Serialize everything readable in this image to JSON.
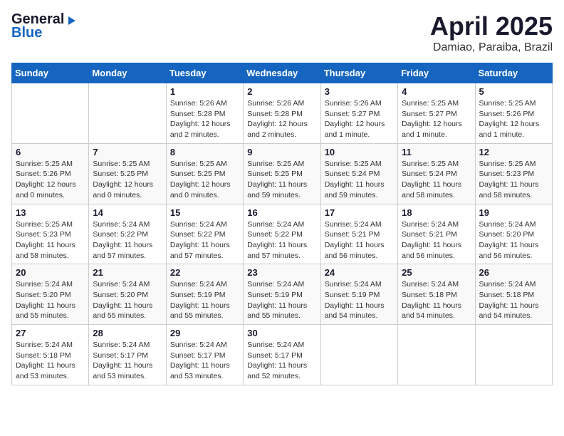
{
  "header": {
    "logo_general": "General",
    "logo_blue": "Blue",
    "month_year": "April 2025",
    "location": "Damiao, Paraiba, Brazil"
  },
  "calendar": {
    "days_of_week": [
      "Sunday",
      "Monday",
      "Tuesday",
      "Wednesday",
      "Thursday",
      "Friday",
      "Saturday"
    ],
    "weeks": [
      [
        {
          "day": "",
          "info": ""
        },
        {
          "day": "",
          "info": ""
        },
        {
          "day": "1",
          "info": "Sunrise: 5:26 AM\nSunset: 5:28 PM\nDaylight: 12 hours\nand 2 minutes."
        },
        {
          "day": "2",
          "info": "Sunrise: 5:26 AM\nSunset: 5:28 PM\nDaylight: 12 hours\nand 2 minutes."
        },
        {
          "day": "3",
          "info": "Sunrise: 5:26 AM\nSunset: 5:27 PM\nDaylight: 12 hours\nand 1 minute."
        },
        {
          "day": "4",
          "info": "Sunrise: 5:25 AM\nSunset: 5:27 PM\nDaylight: 12 hours\nand 1 minute."
        },
        {
          "day": "5",
          "info": "Sunrise: 5:25 AM\nSunset: 5:26 PM\nDaylight: 12 hours\nand 1 minute."
        }
      ],
      [
        {
          "day": "6",
          "info": "Sunrise: 5:25 AM\nSunset: 5:26 PM\nDaylight: 12 hours\nand 0 minutes."
        },
        {
          "day": "7",
          "info": "Sunrise: 5:25 AM\nSunset: 5:25 PM\nDaylight: 12 hours\nand 0 minutes."
        },
        {
          "day": "8",
          "info": "Sunrise: 5:25 AM\nSunset: 5:25 PM\nDaylight: 12 hours\nand 0 minutes."
        },
        {
          "day": "9",
          "info": "Sunrise: 5:25 AM\nSunset: 5:25 PM\nDaylight: 11 hours\nand 59 minutes."
        },
        {
          "day": "10",
          "info": "Sunrise: 5:25 AM\nSunset: 5:24 PM\nDaylight: 11 hours\nand 59 minutes."
        },
        {
          "day": "11",
          "info": "Sunrise: 5:25 AM\nSunset: 5:24 PM\nDaylight: 11 hours\nand 58 minutes."
        },
        {
          "day": "12",
          "info": "Sunrise: 5:25 AM\nSunset: 5:23 PM\nDaylight: 11 hours\nand 58 minutes."
        }
      ],
      [
        {
          "day": "13",
          "info": "Sunrise: 5:25 AM\nSunset: 5:23 PM\nDaylight: 11 hours\nand 58 minutes."
        },
        {
          "day": "14",
          "info": "Sunrise: 5:24 AM\nSunset: 5:22 PM\nDaylight: 11 hours\nand 57 minutes."
        },
        {
          "day": "15",
          "info": "Sunrise: 5:24 AM\nSunset: 5:22 PM\nDaylight: 11 hours\nand 57 minutes."
        },
        {
          "day": "16",
          "info": "Sunrise: 5:24 AM\nSunset: 5:22 PM\nDaylight: 11 hours\nand 57 minutes."
        },
        {
          "day": "17",
          "info": "Sunrise: 5:24 AM\nSunset: 5:21 PM\nDaylight: 11 hours\nand 56 minutes."
        },
        {
          "day": "18",
          "info": "Sunrise: 5:24 AM\nSunset: 5:21 PM\nDaylight: 11 hours\nand 56 minutes."
        },
        {
          "day": "19",
          "info": "Sunrise: 5:24 AM\nSunset: 5:20 PM\nDaylight: 11 hours\nand 56 minutes."
        }
      ],
      [
        {
          "day": "20",
          "info": "Sunrise: 5:24 AM\nSunset: 5:20 PM\nDaylight: 11 hours\nand 55 minutes."
        },
        {
          "day": "21",
          "info": "Sunrise: 5:24 AM\nSunset: 5:20 PM\nDaylight: 11 hours\nand 55 minutes."
        },
        {
          "day": "22",
          "info": "Sunrise: 5:24 AM\nSunset: 5:19 PM\nDaylight: 11 hours\nand 55 minutes."
        },
        {
          "day": "23",
          "info": "Sunrise: 5:24 AM\nSunset: 5:19 PM\nDaylight: 11 hours\nand 55 minutes."
        },
        {
          "day": "24",
          "info": "Sunrise: 5:24 AM\nSunset: 5:19 PM\nDaylight: 11 hours\nand 54 minutes."
        },
        {
          "day": "25",
          "info": "Sunrise: 5:24 AM\nSunset: 5:18 PM\nDaylight: 11 hours\nand 54 minutes."
        },
        {
          "day": "26",
          "info": "Sunrise: 5:24 AM\nSunset: 5:18 PM\nDaylight: 11 hours\nand 54 minutes."
        }
      ],
      [
        {
          "day": "27",
          "info": "Sunrise: 5:24 AM\nSunset: 5:18 PM\nDaylight: 11 hours\nand 53 minutes."
        },
        {
          "day": "28",
          "info": "Sunrise: 5:24 AM\nSunset: 5:17 PM\nDaylight: 11 hours\nand 53 minutes."
        },
        {
          "day": "29",
          "info": "Sunrise: 5:24 AM\nSunset: 5:17 PM\nDaylight: 11 hours\nand 53 minutes."
        },
        {
          "day": "30",
          "info": "Sunrise: 5:24 AM\nSunset: 5:17 PM\nDaylight: 11 hours\nand 52 minutes."
        },
        {
          "day": "",
          "info": ""
        },
        {
          "day": "",
          "info": ""
        },
        {
          "day": "",
          "info": ""
        }
      ]
    ]
  }
}
